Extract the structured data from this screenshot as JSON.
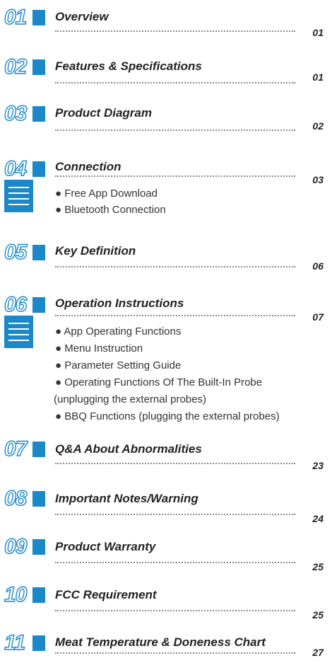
{
  "toc": [
    {
      "number": "01",
      "title": "Overview",
      "page": "01",
      "subitems": []
    },
    {
      "number": "02",
      "title": "Features & Specifications",
      "page": "01",
      "subitems": []
    },
    {
      "number": "03",
      "title": "Product Diagram",
      "page": "02",
      "subitems": []
    },
    {
      "number": "04",
      "title": "Connection",
      "page": "03",
      "subitems": [
        "● Free App Download",
        "● Bluetooth Connection"
      ]
    },
    {
      "number": "05",
      "title": "Key Definition",
      "page": "06",
      "subitems": []
    },
    {
      "number": "06",
      "title": "Operation Instructions",
      "page": "07",
      "subitems": [
        "● App Operating Functions",
        "● Menu Instruction",
        "● Parameter Setting Guide",
        "● Operating Functions Of The Built-In Probe",
        "(unplugging the external probes)",
        "● BBQ Functions (plugging the external probes)"
      ]
    },
    {
      "number": "07",
      "title": "Q&A About Abnormalities",
      "page": "23",
      "subitems": []
    },
    {
      "number": "08",
      "title": "Important Notes/Warning",
      "page": "24",
      "subitems": []
    },
    {
      "number": "09",
      "title": "Product Warranty",
      "page": "25",
      "subitems": []
    },
    {
      "number": "10",
      "title": "FCC Requirement",
      "page": "25",
      "subitems": []
    },
    {
      "number": "11",
      "title": "Meat Temperature & Doneness Chart",
      "page": "27",
      "subitems": []
    }
  ],
  "colors": {
    "accent": "#1a88c9",
    "dots": "#8a8a8a",
    "text": "#222222"
  }
}
